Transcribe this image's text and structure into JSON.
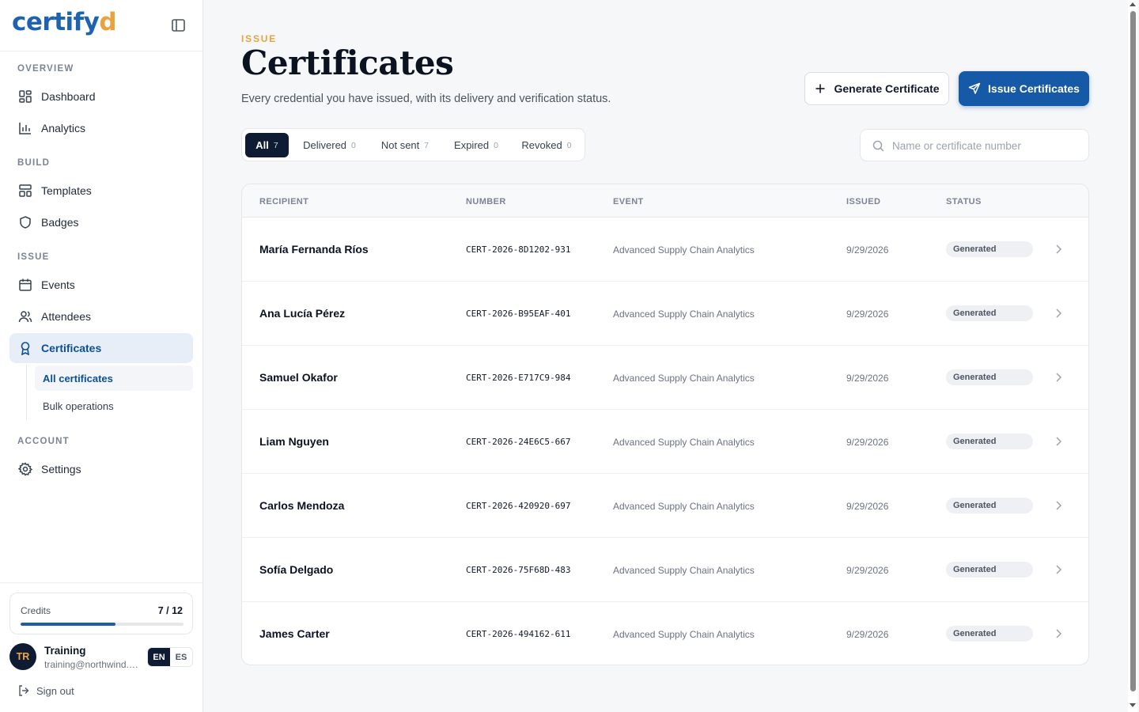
{
  "brand": {
    "logo_main": "certify",
    "logo_accent": "d"
  },
  "nav": {
    "sections": {
      "overview": "OVERVIEW",
      "build": "BUILD",
      "issue": "ISSUE",
      "account": "ACCOUNT"
    },
    "items": {
      "dashboard": "Dashboard",
      "analytics": "Analytics",
      "templates": "Templates",
      "badges": "Badges",
      "events": "Events",
      "attendees": "Attendees",
      "certificates": "Certificates",
      "settings": "Settings"
    },
    "sub_items": {
      "all_certificates": "All certificates",
      "bulk_operations": "Bulk operations"
    }
  },
  "credits": {
    "label": "Credits",
    "value_text": "7 / 12",
    "used": 7,
    "total": 12
  },
  "user": {
    "initials": "TR",
    "name": "Training",
    "email": "training@northwind.example"
  },
  "language": {
    "active": "EN",
    "other": "ES"
  },
  "signout_label": "Sign out",
  "page": {
    "eyebrow": "ISSUE",
    "title": "Certificates",
    "subtitle": "Every credential you have issued, with its delivery and verification status."
  },
  "actions": {
    "generate_label": "Generate Certificate",
    "issue_label": "Issue Certificates"
  },
  "tabs": [
    {
      "label": "All",
      "count": "7"
    },
    {
      "label": "Delivered",
      "count": "0"
    },
    {
      "label": "Not sent",
      "count": "7"
    },
    {
      "label": "Expired",
      "count": "0"
    },
    {
      "label": "Revoked",
      "count": "0"
    }
  ],
  "search": {
    "placeholder": "Name or certificate number",
    "value": ""
  },
  "table": {
    "headers": {
      "recipient": "RECIPIENT",
      "number": "NUMBER",
      "event": "EVENT",
      "issued": "ISSUED",
      "status": "STATUS"
    },
    "rows": [
      {
        "recipient": "María Fernanda Ríos",
        "number": "CERT-2026-8D1202-931",
        "event": "Advanced Supply Chain Analytics",
        "issued": "9/29/2026",
        "status": "Generated"
      },
      {
        "recipient": "Ana Lucía Pérez",
        "number": "CERT-2026-B95EAF-401",
        "event": "Advanced Supply Chain Analytics",
        "issued": "9/29/2026",
        "status": "Generated"
      },
      {
        "recipient": "Samuel Okafor",
        "number": "CERT-2026-E717C9-984",
        "event": "Advanced Supply Chain Analytics",
        "issued": "9/29/2026",
        "status": "Generated"
      },
      {
        "recipient": "Liam Nguyen",
        "number": "CERT-2026-24E6C5-667",
        "event": "Advanced Supply Chain Analytics",
        "issued": "9/29/2026",
        "status": "Generated"
      },
      {
        "recipient": "Carlos Mendoza",
        "number": "CERT-2026-420920-697",
        "event": "Advanced Supply Chain Analytics",
        "issued": "9/29/2026",
        "status": "Generated"
      },
      {
        "recipient": "Sofía Delgado",
        "number": "CERT-2026-75F68D-483",
        "event": "Advanced Supply Chain Analytics",
        "issued": "9/29/2026",
        "status": "Generated"
      },
      {
        "recipient": "James Carter",
        "number": "CERT-2026-494162-611",
        "event": "Advanced Supply Chain Analytics",
        "issued": "9/29/2026",
        "status": "Generated"
      }
    ]
  },
  "colors": {
    "brand": "#1e63b0",
    "accent": "#e8a33d",
    "primary_button": "#1659a6",
    "dark": "#0f1b33"
  }
}
